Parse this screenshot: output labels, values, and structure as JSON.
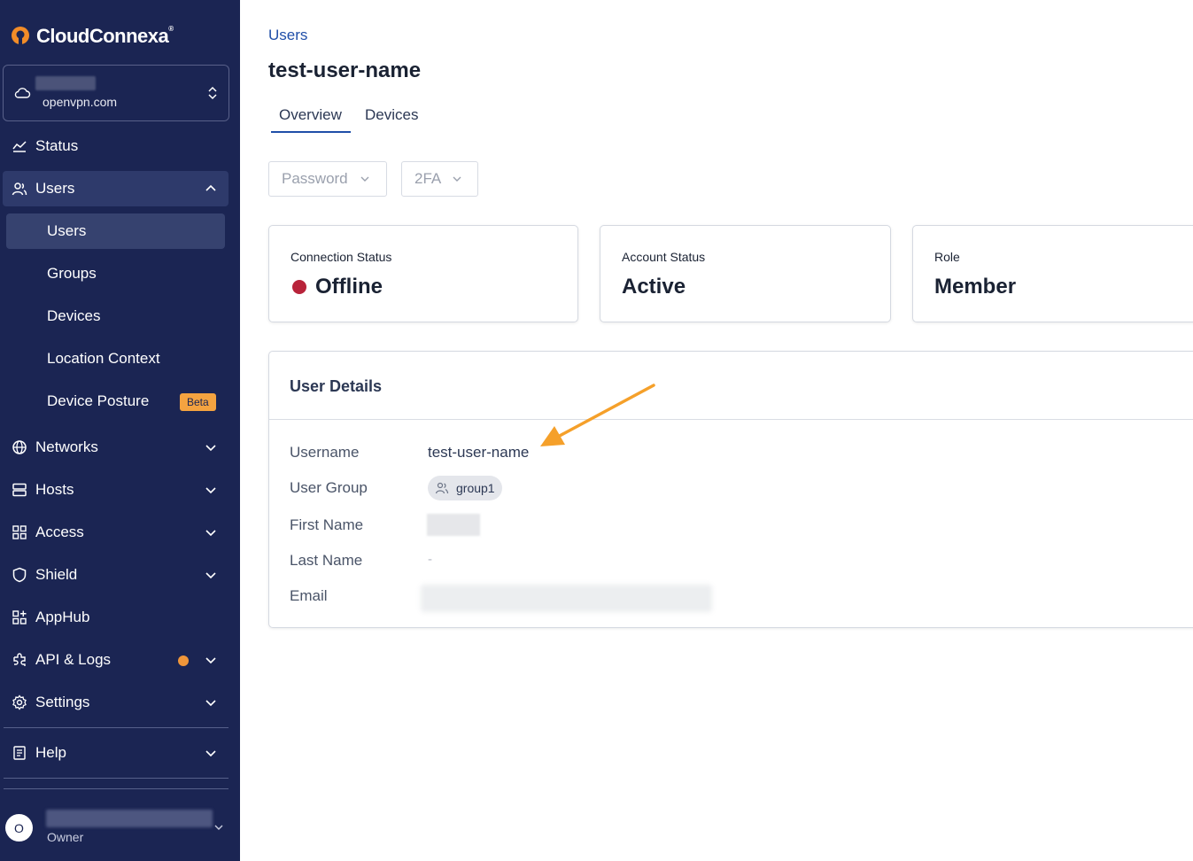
{
  "brand": {
    "name": "CloudConnexa",
    "reg": "®",
    "accent": "#f28c28"
  },
  "tenant": {
    "domain": "openvpn.com"
  },
  "sidebar": {
    "items": [
      {
        "label": "Status"
      },
      {
        "label": "Users"
      },
      {
        "label": "Networks"
      },
      {
        "label": "Hosts"
      },
      {
        "label": "Access"
      },
      {
        "label": "Shield"
      },
      {
        "label": "AppHub"
      },
      {
        "label": "API & Logs"
      },
      {
        "label": "Settings"
      },
      {
        "label": "Help"
      }
    ],
    "users_sub": [
      {
        "label": "Users"
      },
      {
        "label": "Groups"
      },
      {
        "label": "Devices"
      },
      {
        "label": "Location Context"
      },
      {
        "label": "Device Posture",
        "badge": "Beta"
      }
    ],
    "colors": {
      "background": "#1b2553",
      "active": "#36426f",
      "badge": "#f4a340"
    }
  },
  "user": {
    "initial": "O",
    "role": "Owner"
  },
  "breadcrumb": "Users",
  "page_title": "test-user-name",
  "tabs": [
    {
      "label": "Overview"
    },
    {
      "label": "Devices"
    }
  ],
  "filters": {
    "password": "Password",
    "twofa": "2FA"
  },
  "cards": {
    "connection": {
      "label": "Connection Status",
      "value": "Offline",
      "color": "#b8233a"
    },
    "account": {
      "label": "Account Status",
      "value": "Active"
    },
    "role": {
      "label": "Role",
      "value": "Member"
    }
  },
  "details": {
    "title": "User Details",
    "username_label": "Username",
    "username": "test-user-name",
    "group_label": "User Group",
    "group": "group1",
    "first_name_label": "First Name",
    "last_name_label": "Last Name",
    "last_name": "-",
    "email_label": "Email"
  },
  "annotation": {
    "arrow_color": "#f5a02a"
  }
}
